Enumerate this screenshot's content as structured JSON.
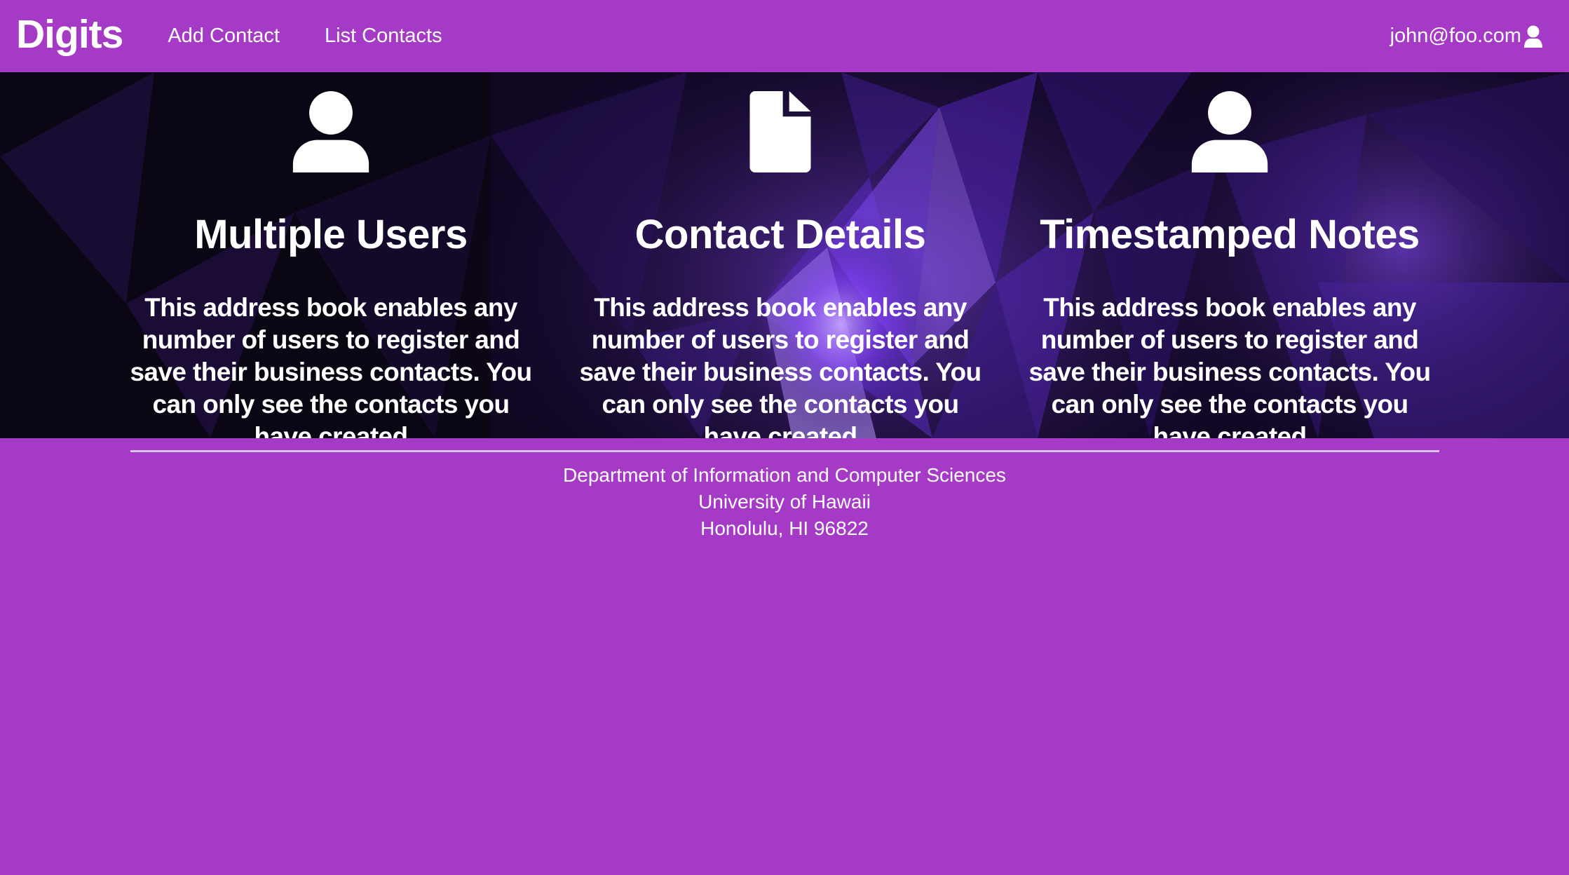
{
  "navbar": {
    "brand": "Digits",
    "links": [
      "Add Contact",
      "List Contacts"
    ],
    "user_email": "john@foo.com"
  },
  "features": [
    {
      "icon": "user-icon",
      "title": "Multiple Users",
      "text": "This address book enables any number of users to register and save their business contacts. You can only see the contacts you have created"
    },
    {
      "icon": "file-icon",
      "title": "Contact Details",
      "text": "This address book enables any number of users to register and save their business contacts. You can only see the contacts you have created"
    },
    {
      "icon": "user-icon",
      "title": "Timestamped Notes",
      "text": "This address book enables any number of users to register and save their business contacts. You can only see the contacts you have created"
    }
  ],
  "footer": {
    "line1": "Department of Information and Computer Sciences",
    "line2": "University of Hawaii",
    "line3": "Honolulu, HI 96822"
  },
  "colors": {
    "primary": "#a43ac5",
    "hero_dark": "#0d0618",
    "text": "#ffffff"
  }
}
